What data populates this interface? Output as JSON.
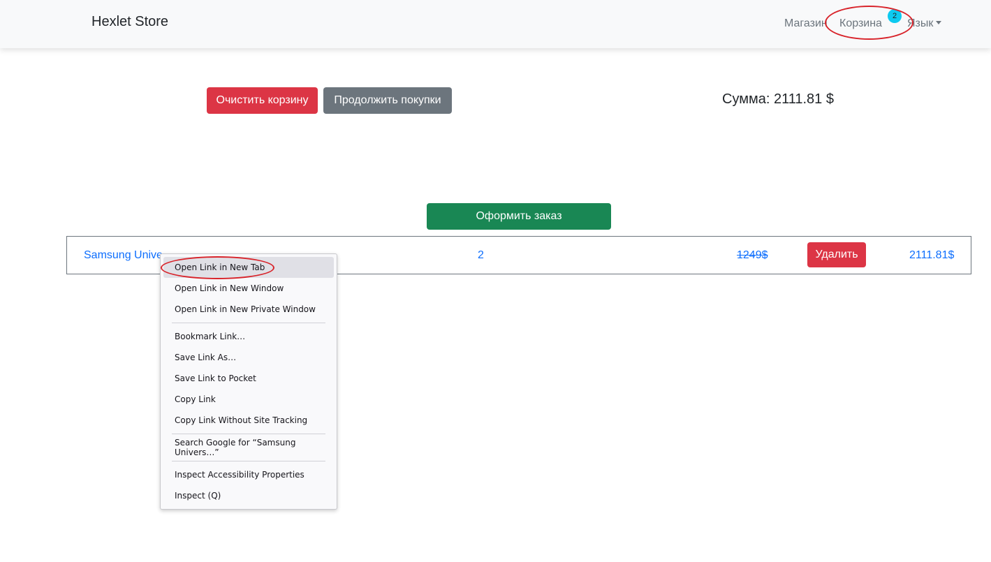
{
  "navbar": {
    "brand": "Hexlet Store",
    "shop_link": "Магазин",
    "cart_link": "Корзина",
    "cart_badge": "2",
    "lang_link": "Язык"
  },
  "actions": {
    "clear_cart": "Очистить корзину",
    "continue_shopping": "Продолжить покупки",
    "place_order": "Оформить заказ"
  },
  "summary": {
    "sum_text": "Сумма: 2111.81 $"
  },
  "cart_items": [
    {
      "name": "Samsung Unive",
      "quantity": "2",
      "old_price": "1249$",
      "delete_label": "Удалить",
      "total": "2111.81$"
    }
  ],
  "context_menu": {
    "items": [
      {
        "label": "Open Link in New Tab"
      },
      {
        "label": "Open Link in New Window"
      },
      {
        "label": "Open Link in New Private Window"
      },
      {
        "label": "Bookmark Link…"
      },
      {
        "label": "Save Link As…"
      },
      {
        "label": "Save Link to Pocket"
      },
      {
        "label": "Copy Link"
      },
      {
        "label": "Copy Link Without Site Tracking"
      },
      {
        "label": "Search Google for “Samsung Univers…”"
      },
      {
        "label": "Inspect Accessibility Properties"
      },
      {
        "label": "Inspect (Q)"
      }
    ]
  },
  "colors": {
    "danger": "#dc3545",
    "secondary": "#6c757d",
    "success": "#198754",
    "link": "#0d6efd",
    "badge": "#0dcaf0",
    "annotation": "#d8232a"
  }
}
